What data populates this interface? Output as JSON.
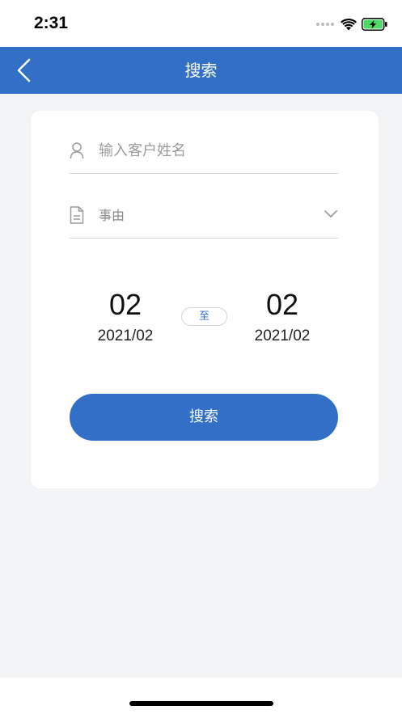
{
  "status_bar": {
    "time": "2:31",
    "icons": [
      "signal-icon",
      "wifi-icon",
      "battery-charging-icon"
    ],
    "battery_color": "#4cd964"
  },
  "nav": {
    "title": "搜索",
    "back_icon": "chevron-left-icon"
  },
  "form": {
    "name_field": {
      "placeholder": "输入客户姓名",
      "value": "",
      "icon": "user-icon"
    },
    "reason_field": {
      "label": "事由",
      "icon": "document-icon",
      "dropdown_icon": "chevron-down-icon"
    },
    "date_range": {
      "start": {
        "day": "02",
        "year_month": "2021/02"
      },
      "separator": "至",
      "end": {
        "day": "02",
        "year_month": "2021/02"
      }
    },
    "search_button_label": "搜索"
  },
  "colors": {
    "primary": "#3270c7",
    "background": "#f2f3f5",
    "card": "#ffffff"
  }
}
